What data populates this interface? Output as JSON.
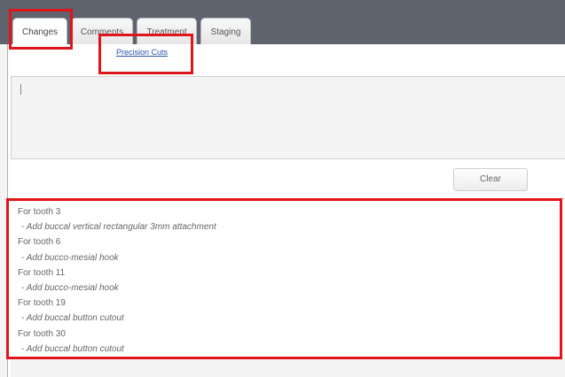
{
  "tabs": [
    {
      "label": "Changes",
      "active": true
    },
    {
      "label": "Comments",
      "active": false
    },
    {
      "label": "Treatment",
      "active": false
    },
    {
      "label": "Staging",
      "active": false
    }
  ],
  "links": {
    "precision_cuts": "Precision Cuts"
  },
  "notes": {
    "value": ""
  },
  "buttons": {
    "clear": "Clear"
  },
  "changes": [
    {
      "text": "For tooth 3",
      "kind": "header"
    },
    {
      "text": "- Add buccal vertical rectangular 3mm attachment",
      "kind": "detail"
    },
    {
      "text": "For tooth 6",
      "kind": "header"
    },
    {
      "text": "- Add bucco-mesial hook",
      "kind": "detail"
    },
    {
      "text": "For tooth 11",
      "kind": "header"
    },
    {
      "text": "- Add bucco-mesial hook",
      "kind": "detail"
    },
    {
      "text": "For tooth 19",
      "kind": "header"
    },
    {
      "text": "- Add buccal button cutout",
      "kind": "detail"
    },
    {
      "text": "For tooth 30",
      "kind": "header"
    },
    {
      "text": "- Add buccal button cutout",
      "kind": "detail"
    }
  ],
  "colors": {
    "tab_strip": "#5f636d",
    "highlight": "#e0151b",
    "link": "#2a4fa8"
  }
}
